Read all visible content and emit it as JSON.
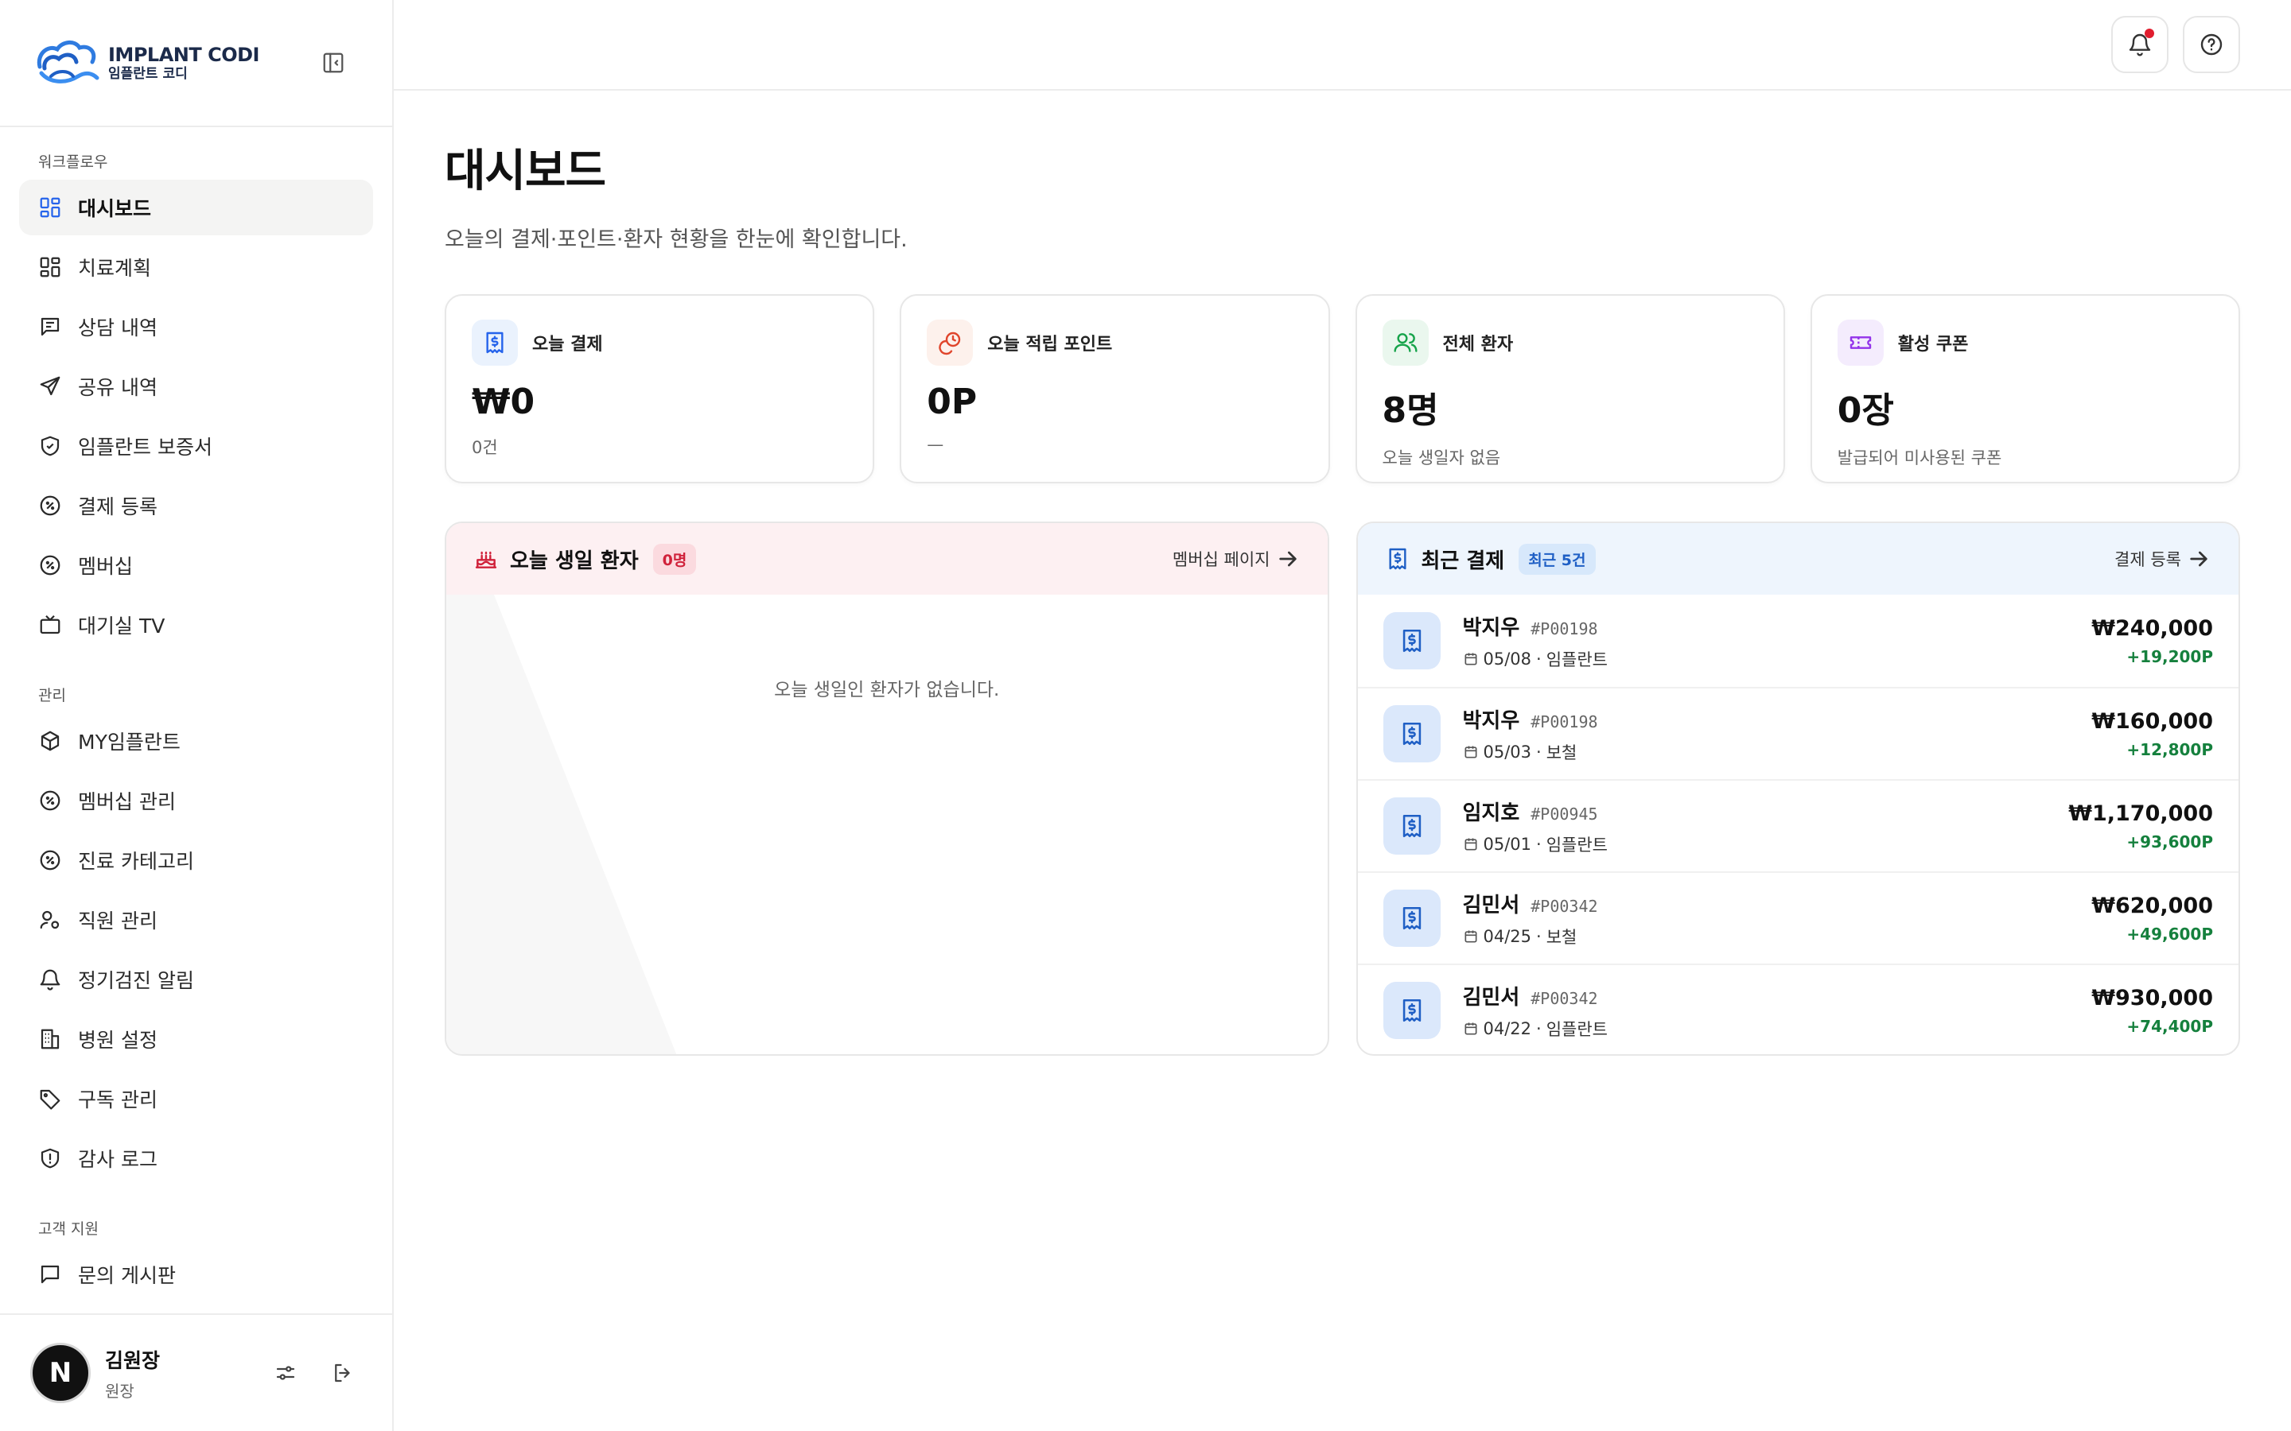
{
  "brand": {
    "name_en": "IMPLANT CODI",
    "name_ko": "임플란트 코디"
  },
  "sidebar": {
    "sections": [
      {
        "label": "워크플로우"
      },
      {
        "label": "관리"
      },
      {
        "label": "고객 지원"
      }
    ],
    "items": [
      {
        "label": "대시보드",
        "icon": "grid-icon",
        "active": true
      },
      {
        "label": "치료계획",
        "icon": "grid-icon"
      },
      {
        "label": "상담 내역",
        "icon": "message-square-icon"
      },
      {
        "label": "공유 내역",
        "icon": "send-icon"
      },
      {
        "label": "임플란트 보증서",
        "icon": "shield-check-icon"
      },
      {
        "label": "결제 등록",
        "icon": "percent-badge-icon"
      },
      {
        "label": "멤버십",
        "icon": "percent-badge-icon"
      },
      {
        "label": "대기실 TV",
        "icon": "tv-icon"
      },
      {
        "label": "MY임플란트",
        "icon": "box-icon"
      },
      {
        "label": "멤버십 관리",
        "icon": "percent-badge-icon"
      },
      {
        "label": "진료 카테고리",
        "icon": "percent-badge-icon"
      },
      {
        "label": "직원 관리",
        "icon": "user-cog-icon"
      },
      {
        "label": "정기검진 알림",
        "icon": "bell-icon"
      },
      {
        "label": "병원 설정",
        "icon": "building-icon"
      },
      {
        "label": "구독 관리",
        "icon": "tag-icon"
      },
      {
        "label": "감사 로그",
        "icon": "shield-alert-icon"
      },
      {
        "label": "문의 게시판",
        "icon": "message-icon"
      }
    ]
  },
  "user": {
    "initial": "N",
    "name": "김원장",
    "role": "원장"
  },
  "page": {
    "title": "대시보드",
    "subtitle": "오늘의 결제·포인트·환자 현황을 한눈에 확인합니다."
  },
  "stats": [
    {
      "label": "오늘 결제",
      "value": "₩0",
      "foot": "0건",
      "icon": "receipt-icon",
      "color": "#2563eb",
      "bg": "#eaf2fd"
    },
    {
      "label": "오늘 적립 포인트",
      "value": "0P",
      "foot": "—",
      "icon": "coins-icon",
      "color": "#e0452c",
      "bg": "#fdf1ec"
    },
    {
      "label": "전체 환자",
      "value": "8명",
      "foot": "오늘 생일자 없음",
      "icon": "users-icon",
      "color": "#16a34a",
      "bg": "#eaf7ee"
    },
    {
      "label": "활성 쿠폰",
      "value": "0장",
      "foot": "발급되어 미사용된 쿠폰",
      "icon": "ticket-icon",
      "color": "#9333ea",
      "bg": "#f4ecfd"
    }
  ],
  "birthday": {
    "title": "오늘 생일 환자",
    "count": "0명",
    "link": "멤버십 페이지",
    "empty": "오늘 생일인 환자가 없습니다."
  },
  "payments": {
    "title": "최근 결제",
    "badge": "최근 5건",
    "link": "결제 등록",
    "rows": [
      {
        "name": "박지우",
        "id": "#P00198",
        "date": "05/08",
        "type": "임플란트",
        "amount": "₩240,000",
        "point": "+19,200P"
      },
      {
        "name": "박지우",
        "id": "#P00198",
        "date": "05/03",
        "type": "보철",
        "amount": "₩160,000",
        "point": "+12,800P"
      },
      {
        "name": "임지호",
        "id": "#P00945",
        "date": "05/01",
        "type": "임플란트",
        "amount": "₩1,170,000",
        "point": "+93,600P"
      },
      {
        "name": "김민서",
        "id": "#P00342",
        "date": "04/25",
        "type": "보철",
        "amount": "₩620,000",
        "point": "+49,600P"
      },
      {
        "name": "김민서",
        "id": "#P00342",
        "date": "04/22",
        "type": "임플란트",
        "amount": "₩930,000",
        "point": "+74,400P"
      }
    ]
  }
}
